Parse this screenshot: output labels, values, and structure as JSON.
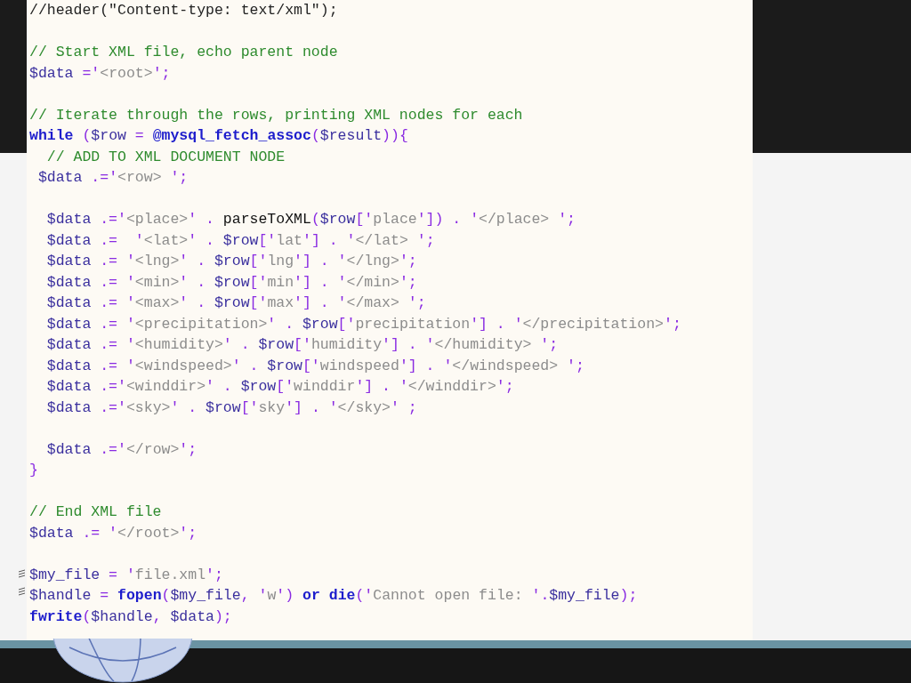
{
  "code_lines": [
    {
      "gap_before": false,
      "tokens": [
        {
          "kind": "plain",
          "text": "//header(\"Content-type: text/xml\");"
        }
      ]
    },
    {
      "gap_before": true,
      "tokens": [
        {
          "kind": "comment",
          "text": "// Start XML file, echo parent node"
        }
      ]
    },
    {
      "gap_before": false,
      "tokens": [
        {
          "kind": "var",
          "text": "$data"
        },
        {
          "kind": "op",
          "text": " ='"
        },
        {
          "kind": "str",
          "text": "<root>"
        },
        {
          "kind": "op",
          "text": "';"
        }
      ]
    },
    {
      "gap_before": true,
      "tokens": [
        {
          "kind": "comment",
          "text": "// Iterate through the rows, printing XML nodes for each"
        }
      ]
    },
    {
      "gap_before": false,
      "tokens": [
        {
          "kind": "keyword",
          "text": "while"
        },
        {
          "kind": "op",
          "text": " ("
        },
        {
          "kind": "var",
          "text": "$row"
        },
        {
          "kind": "op",
          "text": " = "
        },
        {
          "kind": "builtin",
          "text": "@mysql_fetch_assoc"
        },
        {
          "kind": "op",
          "text": "("
        },
        {
          "kind": "var",
          "text": "$result"
        },
        {
          "kind": "op",
          "text": ")){"
        }
      ]
    },
    {
      "gap_before": false,
      "tokens": [
        {
          "kind": "comment",
          "text": "  // ADD TO XML DOCUMENT NODE"
        }
      ]
    },
    {
      "gap_before": false,
      "tokens": [
        {
          "kind": "var",
          "text": " $data"
        },
        {
          "kind": "op",
          "text": " .='"
        },
        {
          "kind": "str",
          "text": "<row> "
        },
        {
          "kind": "op",
          "text": "';"
        }
      ]
    },
    {
      "gap_before": true,
      "tokens": [
        {
          "kind": "var",
          "text": "  $data"
        },
        {
          "kind": "op",
          "text": " .='"
        },
        {
          "kind": "str",
          "text": "<place>"
        },
        {
          "kind": "op",
          "text": "' . "
        },
        {
          "kind": "func",
          "text": "parseToXML"
        },
        {
          "kind": "op",
          "text": "("
        },
        {
          "kind": "var",
          "text": "$row"
        },
        {
          "kind": "op",
          "text": "['"
        },
        {
          "kind": "str",
          "text": "place"
        },
        {
          "kind": "op",
          "text": "']) . '"
        },
        {
          "kind": "str",
          "text": "</place> "
        },
        {
          "kind": "op",
          "text": "';"
        }
      ]
    },
    {
      "gap_before": false,
      "tokens": [
        {
          "kind": "var",
          "text": "  $data"
        },
        {
          "kind": "op",
          "text": " .=  '"
        },
        {
          "kind": "str",
          "text": "<lat>"
        },
        {
          "kind": "op",
          "text": "' . "
        },
        {
          "kind": "var",
          "text": "$row"
        },
        {
          "kind": "op",
          "text": "['"
        },
        {
          "kind": "str",
          "text": "lat"
        },
        {
          "kind": "op",
          "text": "'] . '"
        },
        {
          "kind": "str",
          "text": "</lat> "
        },
        {
          "kind": "op",
          "text": "';"
        }
      ]
    },
    {
      "gap_before": false,
      "tokens": [
        {
          "kind": "var",
          "text": "  $data"
        },
        {
          "kind": "op",
          "text": " .= '"
        },
        {
          "kind": "str",
          "text": "<lng>"
        },
        {
          "kind": "op",
          "text": "' . "
        },
        {
          "kind": "var",
          "text": "$row"
        },
        {
          "kind": "op",
          "text": "['"
        },
        {
          "kind": "str",
          "text": "lng"
        },
        {
          "kind": "op",
          "text": "'] . '"
        },
        {
          "kind": "str",
          "text": "</lng>"
        },
        {
          "kind": "op",
          "text": "';"
        }
      ]
    },
    {
      "gap_before": false,
      "tokens": [
        {
          "kind": "var",
          "text": "  $data"
        },
        {
          "kind": "op",
          "text": " .= '"
        },
        {
          "kind": "str",
          "text": "<min>"
        },
        {
          "kind": "op",
          "text": "' . "
        },
        {
          "kind": "var",
          "text": "$row"
        },
        {
          "kind": "op",
          "text": "['"
        },
        {
          "kind": "str",
          "text": "min"
        },
        {
          "kind": "op",
          "text": "'] . '"
        },
        {
          "kind": "str",
          "text": "</min>"
        },
        {
          "kind": "op",
          "text": "';"
        }
      ]
    },
    {
      "gap_before": false,
      "tokens": [
        {
          "kind": "var",
          "text": "  $data"
        },
        {
          "kind": "op",
          "text": " .= '"
        },
        {
          "kind": "str",
          "text": "<max>"
        },
        {
          "kind": "op",
          "text": "' . "
        },
        {
          "kind": "var",
          "text": "$row"
        },
        {
          "kind": "op",
          "text": "['"
        },
        {
          "kind": "str",
          "text": "max"
        },
        {
          "kind": "op",
          "text": "'] . '"
        },
        {
          "kind": "str",
          "text": "</max> "
        },
        {
          "kind": "op",
          "text": "';"
        }
      ]
    },
    {
      "gap_before": false,
      "tokens": [
        {
          "kind": "var",
          "text": "  $data"
        },
        {
          "kind": "op",
          "text": " .= '"
        },
        {
          "kind": "str",
          "text": "<precipitation>"
        },
        {
          "kind": "op",
          "text": "' . "
        },
        {
          "kind": "var",
          "text": "$row"
        },
        {
          "kind": "op",
          "text": "['"
        },
        {
          "kind": "str",
          "text": "precipitation"
        },
        {
          "kind": "op",
          "text": "'] . '"
        },
        {
          "kind": "str",
          "text": "</precipitation>"
        },
        {
          "kind": "op",
          "text": "';"
        }
      ]
    },
    {
      "gap_before": false,
      "tokens": [
        {
          "kind": "var",
          "text": "  $data"
        },
        {
          "kind": "op",
          "text": " .= '"
        },
        {
          "kind": "str",
          "text": "<humidity>"
        },
        {
          "kind": "op",
          "text": "' . "
        },
        {
          "kind": "var",
          "text": "$row"
        },
        {
          "kind": "op",
          "text": "['"
        },
        {
          "kind": "str",
          "text": "humidity"
        },
        {
          "kind": "op",
          "text": "'] . '"
        },
        {
          "kind": "str",
          "text": "</humidity> "
        },
        {
          "kind": "op",
          "text": "';"
        }
      ]
    },
    {
      "gap_before": false,
      "tokens": [
        {
          "kind": "var",
          "text": "  $data"
        },
        {
          "kind": "op",
          "text": " .= '"
        },
        {
          "kind": "str",
          "text": "<windspeed>"
        },
        {
          "kind": "op",
          "text": "' . "
        },
        {
          "kind": "var",
          "text": "$row"
        },
        {
          "kind": "op",
          "text": "['"
        },
        {
          "kind": "str",
          "text": "windspeed"
        },
        {
          "kind": "op",
          "text": "'] . '"
        },
        {
          "kind": "str",
          "text": "</windspeed> "
        },
        {
          "kind": "op",
          "text": "';"
        }
      ]
    },
    {
      "gap_before": false,
      "tokens": [
        {
          "kind": "var",
          "text": "  $data"
        },
        {
          "kind": "op",
          "text": " .='"
        },
        {
          "kind": "str",
          "text": "<winddir>"
        },
        {
          "kind": "op",
          "text": "' . "
        },
        {
          "kind": "var",
          "text": "$row"
        },
        {
          "kind": "op",
          "text": "['"
        },
        {
          "kind": "str",
          "text": "winddir"
        },
        {
          "kind": "op",
          "text": "'] . '"
        },
        {
          "kind": "str",
          "text": "</winddir>"
        },
        {
          "kind": "op",
          "text": "';"
        }
      ]
    },
    {
      "gap_before": false,
      "tokens": [
        {
          "kind": "var",
          "text": "  $data"
        },
        {
          "kind": "op",
          "text": " .='"
        },
        {
          "kind": "str",
          "text": "<sky>"
        },
        {
          "kind": "op",
          "text": "' . "
        },
        {
          "kind": "var",
          "text": "$row"
        },
        {
          "kind": "op",
          "text": "['"
        },
        {
          "kind": "str",
          "text": "sky"
        },
        {
          "kind": "op",
          "text": "'] . '"
        },
        {
          "kind": "str",
          "text": "</sky>"
        },
        {
          "kind": "op",
          "text": "' ;"
        }
      ]
    },
    {
      "gap_before": true,
      "tokens": [
        {
          "kind": "var",
          "text": "  $data"
        },
        {
          "kind": "op",
          "text": " .='"
        },
        {
          "kind": "str",
          "text": "</row>"
        },
        {
          "kind": "op",
          "text": "';"
        }
      ]
    },
    {
      "gap_before": false,
      "tokens": [
        {
          "kind": "op",
          "text": "}"
        }
      ]
    },
    {
      "gap_before": true,
      "tokens": [
        {
          "kind": "comment",
          "text": "// End XML file"
        }
      ]
    },
    {
      "gap_before": false,
      "tokens": [
        {
          "kind": "var",
          "text": "$data"
        },
        {
          "kind": "op",
          "text": " .= '"
        },
        {
          "kind": "str",
          "text": "</root>"
        },
        {
          "kind": "op",
          "text": "';"
        }
      ]
    },
    {
      "gap_before": true,
      "tokens": [
        {
          "kind": "var",
          "text": "$my_file"
        },
        {
          "kind": "op",
          "text": " = '"
        },
        {
          "kind": "str",
          "text": "file.xml"
        },
        {
          "kind": "op",
          "text": "';"
        }
      ]
    },
    {
      "gap_before": false,
      "tokens": [
        {
          "kind": "var",
          "text": "$handle"
        },
        {
          "kind": "op",
          "text": " = "
        },
        {
          "kind": "builtin",
          "text": "fopen"
        },
        {
          "kind": "op",
          "text": "("
        },
        {
          "kind": "var",
          "text": "$my_file"
        },
        {
          "kind": "op",
          "text": ", '"
        },
        {
          "kind": "str",
          "text": "w"
        },
        {
          "kind": "op",
          "text": "') "
        },
        {
          "kind": "keyword",
          "text": "or "
        },
        {
          "kind": "builtin",
          "text": "die"
        },
        {
          "kind": "op",
          "text": "('"
        },
        {
          "kind": "str",
          "text": "Cannot open file: "
        },
        {
          "kind": "op",
          "text": "'."
        },
        {
          "kind": "var",
          "text": "$my_file"
        },
        {
          "kind": "op",
          "text": ");"
        }
      ]
    },
    {
      "gap_before": false,
      "tokens": [
        {
          "kind": "builtin",
          "text": "fwrite"
        },
        {
          "kind": "op",
          "text": "("
        },
        {
          "kind": "var",
          "text": "$handle"
        },
        {
          "kind": "op",
          "text": ", "
        },
        {
          "kind": "var",
          "text": "$data"
        },
        {
          "kind": "op",
          "text": ");"
        }
      ]
    }
  ]
}
